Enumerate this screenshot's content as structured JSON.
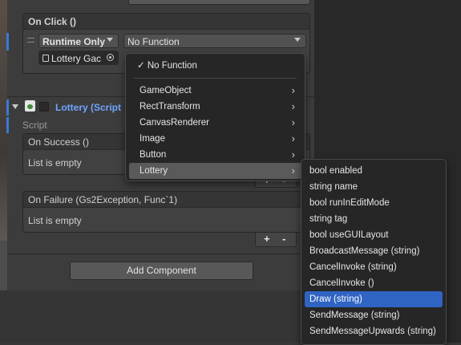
{
  "on_click": {
    "title": "On Click ()",
    "runtime_option": "Runtime Only",
    "function_value": "No Function",
    "object_field": "Lottery Gac"
  },
  "component": {
    "title": "Lottery (Script",
    "script_label": "Script"
  },
  "on_success": {
    "title": "On Success ()",
    "empty_text": "List is empty",
    "plus": "+",
    "minus": "-"
  },
  "on_failure": {
    "title": "On Failure (Gs2Exception, Func`1)",
    "empty_text": "List is empty",
    "plus": "+",
    "minus": "-"
  },
  "add_component_label": "Add Component",
  "menu": {
    "checked_item": "No Function",
    "check_glyph": "✓",
    "items": [
      "GameObject",
      "RectTransform",
      "CanvasRenderer",
      "Image",
      "Button",
      "Lottery"
    ]
  },
  "submenu": {
    "items": [
      "bool enabled",
      "string name",
      "bool runInEditMode",
      "string tag",
      "bool useGUILayout",
      "BroadcastMessage (string)",
      "CancelInvoke (string)",
      "CancelInvoke ()",
      "Draw (string)",
      "SendMessage (string)",
      "SendMessageUpwards (string)"
    ],
    "selected_index": 8
  },
  "colors": {
    "accent": "#3a79d9",
    "selection": "#2f64c3",
    "panel": "#3c3c3c",
    "menu_bg": "#262626"
  },
  "icons": {
    "chevron": "chevron-right-icon",
    "script": "script-component-icon",
    "target": "object-picker-icon"
  }
}
